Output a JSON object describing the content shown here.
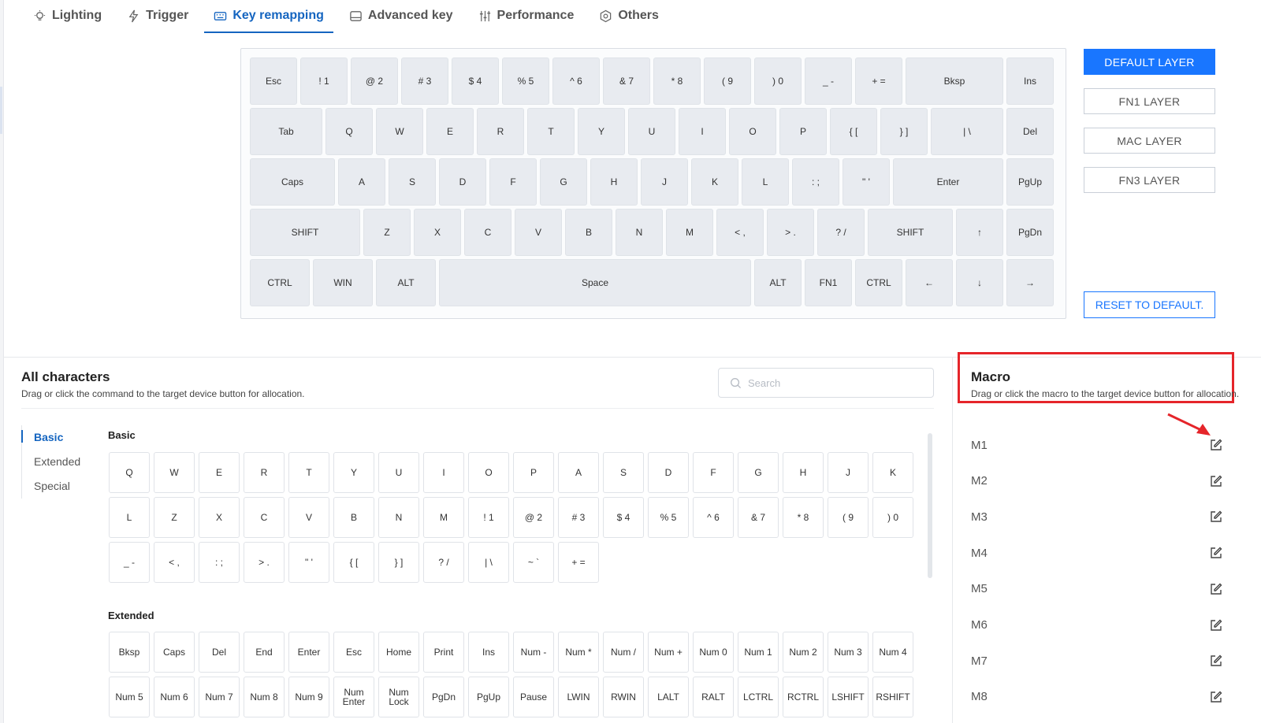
{
  "tabs": [
    {
      "label": "Lighting",
      "icon": "bulb-icon",
      "active": false
    },
    {
      "label": "Trigger",
      "icon": "bolt-icon",
      "active": false
    },
    {
      "label": "Key remapping",
      "icon": "keyboard-icon",
      "active": true
    },
    {
      "label": "Advanced key",
      "icon": "advanced-key-icon",
      "active": false
    },
    {
      "label": "Performance",
      "icon": "sliders-icon",
      "active": false
    },
    {
      "label": "Others",
      "icon": "hexagon-gear-icon",
      "active": false
    }
  ],
  "keyboard": {
    "rows": [
      [
        "Esc",
        "! 1",
        "@ 2",
        "# 3",
        "$ 4",
        "% 5",
        "^ 6",
        "& 7",
        "* 8",
        "( 9",
        ") 0",
        "_ -",
        "+ =",
        "Bksp",
        "Ins"
      ],
      [
        "Tab",
        "Q",
        "W",
        "E",
        "R",
        "T",
        "Y",
        "U",
        "I",
        "O",
        "P",
        "{ [",
        "} ]",
        "| \\",
        "Del"
      ],
      [
        "Caps",
        "A",
        "S",
        "D",
        "F",
        "G",
        "H",
        "J",
        "K",
        "L",
        ": ;",
        "\" '",
        "Enter",
        "PgUp"
      ],
      [
        "SHIFT",
        "Z",
        "X",
        "C",
        "V",
        "B",
        "N",
        "M",
        "< ,",
        "> .",
        "? /",
        "SHIFT",
        "↑",
        "PgDn"
      ],
      [
        "CTRL",
        "WIN",
        "ALT",
        "Space",
        "ALT",
        "FN1",
        "CTRL",
        "←",
        "↓",
        "→"
      ]
    ]
  },
  "layers": {
    "items": [
      "DEFAULT LAYER",
      "FN1 LAYER",
      "MAC LAYER",
      "FN3 LAYER"
    ],
    "active": "DEFAULT LAYER",
    "reset_label": "RESET TO DEFAULT."
  },
  "all_characters": {
    "title": "All characters",
    "description": "Drag or click the command to the target device button for allocation.",
    "search_placeholder": "Search",
    "categories": [
      "Basic",
      "Extended",
      "Special"
    ],
    "active_category": "Basic",
    "sections": [
      {
        "title": "Basic",
        "keys": [
          "Q",
          "W",
          "E",
          "R",
          "T",
          "Y",
          "U",
          "I",
          "O",
          "P",
          "A",
          "S",
          "D",
          "F",
          "G",
          "H",
          "J",
          "K",
          "L",
          "Z",
          "X",
          "C",
          "V",
          "B",
          "N",
          "M",
          "! 1",
          "@ 2",
          "# 3",
          "$ 4",
          "% 5",
          "^ 6",
          "& 7",
          "* 8",
          "( 9",
          ") 0",
          "_ -",
          "< ,",
          ": ;",
          "> .",
          "\" '",
          "{ [",
          "} ]",
          "? /",
          "| \\",
          "~ `",
          "+ ="
        ]
      },
      {
        "title": "Extended",
        "keys": [
          "Bksp",
          "Caps",
          "Del",
          "End",
          "Enter",
          "Esc",
          "Home",
          "Print",
          "Ins",
          "Num -",
          "Num *",
          "Num /",
          "Num +",
          "Num 0",
          "Num 1",
          "Num 2",
          "Num 3",
          "Num 4",
          "Num 5",
          "Num 6",
          "Num 7",
          "Num 8",
          "Num 9",
          "Num Enter",
          "Num Lock",
          "PgDn",
          "PgUp",
          "Pause",
          "LWIN",
          "RWIN",
          "LALT",
          "RALT",
          "LCTRL",
          "RCTRL",
          "LSHIFT",
          "RSHIFT"
        ]
      }
    ]
  },
  "macro": {
    "title": "Macro",
    "description": "Drag or click the macro to the target device button for allocation.",
    "items": [
      "M1",
      "M2",
      "M3",
      "M4",
      "M5",
      "M6",
      "M7",
      "M8"
    ],
    "highlight_color": "#e5252a"
  },
  "colors": {
    "accent": "#1976ff",
    "active_tab": "#1565c0",
    "key_bg": "#e8ebf0"
  }
}
